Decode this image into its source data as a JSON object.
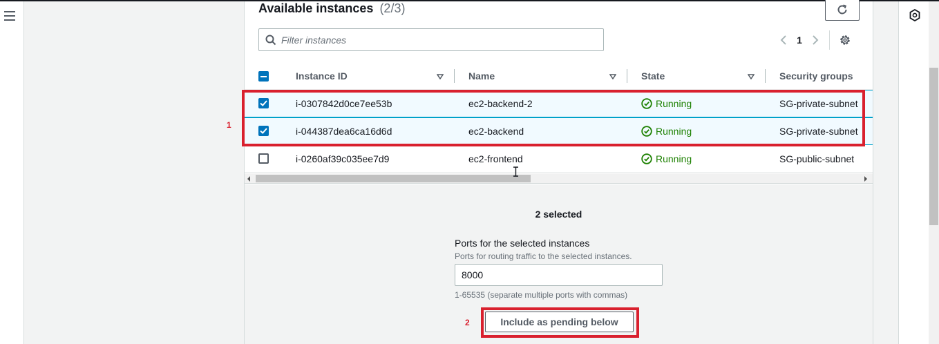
{
  "panel": {
    "title": "Available instances",
    "count": "(2/3)"
  },
  "filter": {
    "placeholder": "Filter instances",
    "value": ""
  },
  "pagination": {
    "current_page": "1"
  },
  "table": {
    "columns": [
      "Instance ID",
      "Name",
      "State",
      "Security groups"
    ],
    "rows": [
      {
        "selected": true,
        "instance_id": "i-0307842d0ce7ee53b",
        "name": "ec2-backend-2",
        "state": "Running",
        "security_group": "SG-private-subnet"
      },
      {
        "selected": true,
        "instance_id": "i-044387dea6ca16d6d",
        "name": "ec2-backend",
        "state": "Running",
        "security_group": "SG-private-subnet"
      },
      {
        "selected": false,
        "instance_id": "i-0260af39c035ee7d9",
        "name": "ec2-frontend",
        "state": "Running",
        "security_group": "SG-public-subnet"
      }
    ]
  },
  "selection": {
    "summary": "2 selected"
  },
  "ports": {
    "label": "Ports for the selected instances",
    "description": "Ports for routing traffic to the selected instances.",
    "value": "8000",
    "hint": "1-65535 (separate multiple ports with commas)"
  },
  "include_button_label": "Include as pending below",
  "annotations": {
    "first": "1",
    "second": "2"
  },
  "icons": {
    "menu": "menu-icon",
    "refresh": "refresh-icon",
    "search": "search-icon",
    "settings": "gear-icon",
    "running": "check-circle-icon",
    "right_rail": "shield-icon"
  },
  "colors": {
    "accent_blue": "#0073bb",
    "status_green": "#1d8102",
    "annotation_red": "#d9202e",
    "selected_row_bg": "#f1faff"
  }
}
